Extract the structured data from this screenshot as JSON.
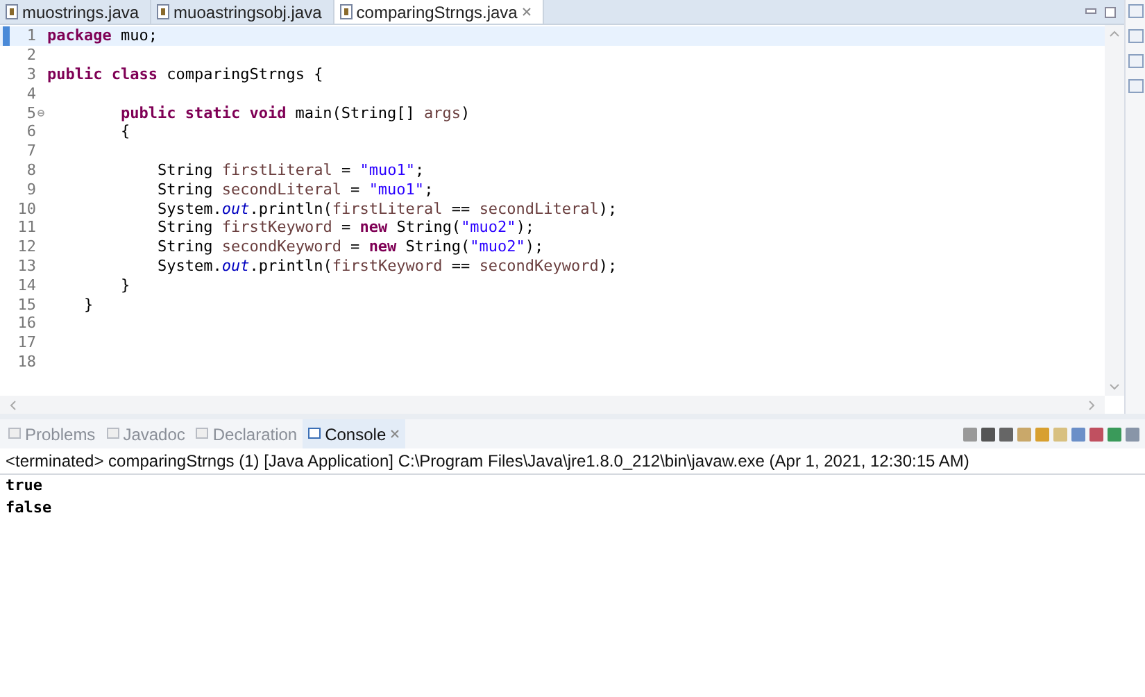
{
  "editor_tabs": [
    {
      "label": "muostrings.java",
      "selected": false
    },
    {
      "label": "muoastringsobj.java",
      "selected": false
    },
    {
      "label": "comparingStrngs.java",
      "selected": true
    }
  ],
  "editor": {
    "lines": [
      {
        "number": "1",
        "current": true,
        "foldable": false,
        "tokens": [
          {
            "kind": "keyword",
            "text": "package"
          },
          {
            "kind": "plain",
            "text": " muo;"
          }
        ]
      },
      {
        "number": "2",
        "current": false,
        "foldable": false
      },
      {
        "number": "3",
        "current": false,
        "foldable": false,
        "tokens": [
          {
            "kind": "keyword",
            "text": "public class"
          },
          {
            "kind": "plain",
            "text": " comparingStrngs {"
          }
        ]
      },
      {
        "number": "4",
        "current": false,
        "foldable": false
      },
      {
        "number": "5",
        "current": false,
        "foldable": true,
        "tokens": [
          {
            "kind": "keyword",
            "text": "        public static void"
          },
          {
            "kind": "plain",
            "text": " main(String[] "
          },
          {
            "kind": "variable",
            "text": "args"
          },
          {
            "kind": "plain",
            "text": ")"
          }
        ]
      },
      {
        "number": "6",
        "current": false,
        "foldable": false,
        "tokens": [
          {
            "kind": "plain",
            "text": "        {"
          }
        ]
      },
      {
        "number": "7",
        "current": false,
        "foldable": false
      },
      {
        "number": "8",
        "current": false,
        "foldable": false,
        "tokens": [
          {
            "kind": "plain",
            "text": "            String "
          },
          {
            "kind": "variable",
            "text": "firstLiteral"
          },
          {
            "kind": "plain",
            "text": " = "
          },
          {
            "kind": "string",
            "text": "\"muo1\""
          },
          {
            "kind": "plain",
            "text": ";"
          }
        ]
      },
      {
        "number": "9",
        "current": false,
        "foldable": false,
        "tokens": [
          {
            "kind": "plain",
            "text": "            String "
          },
          {
            "kind": "variable",
            "text": "secondLiteral"
          },
          {
            "kind": "plain",
            "text": " = "
          },
          {
            "kind": "string",
            "text": "\"muo1\""
          },
          {
            "kind": "plain",
            "text": ";"
          }
        ]
      },
      {
        "number": "10",
        "current": false,
        "foldable": false,
        "tokens": [
          {
            "kind": "plain",
            "text": "            System."
          },
          {
            "kind": "static",
            "text": "out"
          },
          {
            "kind": "plain",
            "text": ".println("
          },
          {
            "kind": "variable",
            "text": "firstLiteral"
          },
          {
            "kind": "plain",
            "text": " == "
          },
          {
            "kind": "variable",
            "text": "secondLiteral"
          },
          {
            "kind": "plain",
            "text": ");"
          }
        ]
      },
      {
        "number": "11",
        "current": false,
        "foldable": false,
        "tokens": [
          {
            "kind": "plain",
            "text": "            String "
          },
          {
            "kind": "variable",
            "text": "firstKeyword"
          },
          {
            "kind": "plain",
            "text": " = "
          },
          {
            "kind": "keyword",
            "text": "new"
          },
          {
            "kind": "plain",
            "text": " String("
          },
          {
            "kind": "string",
            "text": "\"muo2\""
          },
          {
            "kind": "plain",
            "text": ");"
          }
        ]
      },
      {
        "number": "12",
        "current": false,
        "foldable": false,
        "tokens": [
          {
            "kind": "plain",
            "text": "            String "
          },
          {
            "kind": "variable",
            "text": "secondKeyword"
          },
          {
            "kind": "plain",
            "text": " = "
          },
          {
            "kind": "keyword",
            "text": "new"
          },
          {
            "kind": "plain",
            "text": " String("
          },
          {
            "kind": "string",
            "text": "\"muo2\""
          },
          {
            "kind": "plain",
            "text": ");"
          }
        ]
      },
      {
        "number": "13",
        "current": false,
        "foldable": false,
        "tokens": [
          {
            "kind": "plain",
            "text": "            System."
          },
          {
            "kind": "static",
            "text": "out"
          },
          {
            "kind": "plain",
            "text": ".println("
          },
          {
            "kind": "variable",
            "text": "firstKeyword"
          },
          {
            "kind": "plain",
            "text": " == "
          },
          {
            "kind": "variable",
            "text": "secondKeyword"
          },
          {
            "kind": "plain",
            "text": ");"
          }
        ]
      },
      {
        "number": "14",
        "current": false,
        "foldable": false,
        "tokens": [
          {
            "kind": "plain",
            "text": "        }"
          }
        ]
      },
      {
        "number": "15",
        "current": false,
        "foldable": false,
        "tokens": [
          {
            "kind": "plain",
            "text": "    }"
          }
        ]
      },
      {
        "number": "16",
        "current": false,
        "foldable": false
      },
      {
        "number": "17",
        "current": false,
        "foldable": false
      },
      {
        "number": "18",
        "current": false,
        "foldable": false
      }
    ]
  },
  "console_tabs": [
    {
      "label": "Problems",
      "selected": false
    },
    {
      "label": "Javadoc",
      "selected": false
    },
    {
      "label": "Declaration",
      "selected": false
    },
    {
      "label": "Console",
      "selected": true
    }
  ],
  "console": {
    "status": "<terminated> comparingStrngs (1) [Java Application] C:\\Program Files\\Java\\jre1.8.0_212\\bin\\javaw.exe (Apr 1, 2021, 12:30:15 AM)",
    "output": [
      "true",
      "false"
    ]
  }
}
